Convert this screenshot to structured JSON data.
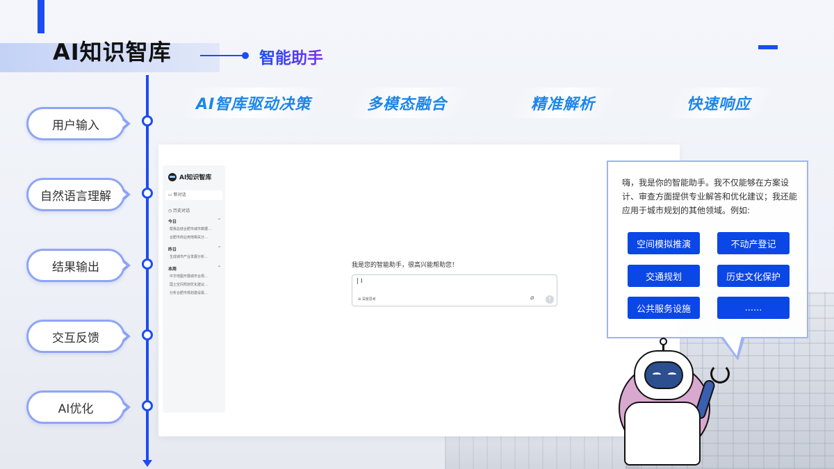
{
  "header": {
    "title": "AI知识智库",
    "section": "智能助手"
  },
  "timeline": {
    "steps": [
      "用户输入",
      "自然语言理解",
      "结果输出",
      "交互反馈",
      "AI优化"
    ]
  },
  "features": [
    "AI智库驱动决策",
    "多模态融合",
    "精准解析",
    "快速响应"
  ],
  "app": {
    "logo": "AI知识智库",
    "new_chat": "新对话",
    "history": "历史对话",
    "groups": [
      {
        "label": "今日",
        "items": [
          "帮我总结合肥市城市数据…",
          "合肥市商业用地相关分…"
        ]
      },
      {
        "label": "昨日",
        "items": [
          "生成城市产业发展分析…"
        ]
      },
      {
        "label": "本周",
        "items": [
          "中华地图开展城市合规…",
          "国土空间规划优化建议…",
          "分析合肥市规划建设需…"
        ]
      }
    ],
    "greeting": "我是您的智能助手，很高兴能帮助您！",
    "input_cursor": "|  I",
    "deep_think": "深度思考",
    "clip_icon": "paperclip-icon",
    "send_icon": "send-icon"
  },
  "bubble": {
    "intro": "嗨，我是你的智能助手。我不仅能够在方案设计、审查方面提供专业解答和优化建议；我还能应用于城市规划的其他领域。例如:",
    "chips": [
      "空间模拟推演",
      "不动产登记",
      "交通规划",
      "历史文化保护",
      "公共服务设施",
      "......"
    ]
  },
  "colors": {
    "accent": "#1c4df0",
    "chip": "#0b46e6",
    "feature_text": "#1d86e8",
    "pill_border": "#8fa5f5"
  }
}
